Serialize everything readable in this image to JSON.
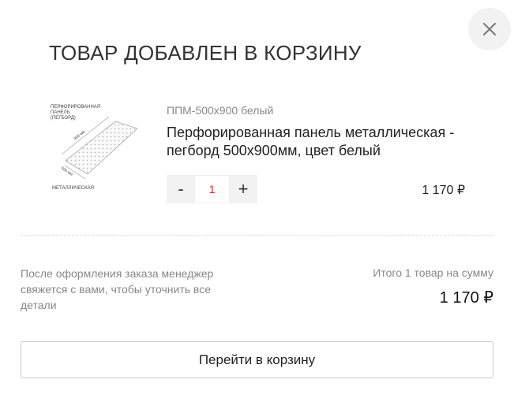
{
  "modal": {
    "title": "ТОВАР ДОБАВЛЕН В КОРЗИНУ",
    "close_icon": "close-icon"
  },
  "product": {
    "sku": "ППМ-500х900 белый",
    "name": "Перфорированная панель металлическая - пегборд 500х900мм, цвет белый",
    "image_labels": {
      "top": "ПЕРФОРИРОВАННАЯ",
      "top2": "ПАНЕЛЬ",
      "top3": "(ПЕГБОРД)",
      "length": "900 мм",
      "width": "500 мм",
      "bottom": "МЕТАЛЛИЧЕСКАЯ"
    },
    "quantity": "1",
    "minus_label": "-",
    "plus_label": "+",
    "price": "1 170 ₽"
  },
  "summary": {
    "info": "После оформления заказа менеджер свяжется с вами, чтобы уточнить все детали",
    "total_label": "Итого 1 товар на сумму",
    "total_price": "1 170 ₽"
  },
  "actions": {
    "go_to_cart_label": "Перейти в корзину"
  },
  "colors": {
    "accent": "#e0262b",
    "muted_text": "#888888",
    "button_bg": "#f2f2f2"
  }
}
